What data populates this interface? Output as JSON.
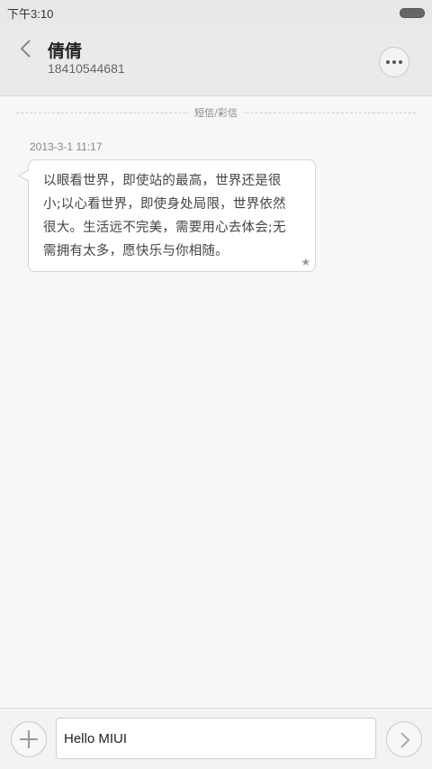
{
  "status_bar": {
    "time": "下午3:10"
  },
  "header": {
    "contact_name": "倩倩",
    "phone_number": "18410544681"
  },
  "conversation": {
    "divider_label": "短信/彩信",
    "messages": [
      {
        "timestamp": "2013-3-1 11:17",
        "text": "以眼看世界，即使站的最高，世界还是很小;以心看世界，即使身处局限，世界依然很大。生活远不完美，需要用心去体会;无需拥有太多，愿快乐与你相随。",
        "starred": true
      }
    ]
  },
  "composer": {
    "input_value": "Hello MIUI"
  },
  "icons": {
    "back": "chevron-left-icon",
    "more": "more-dots-icon",
    "star": "star-icon",
    "attach": "plus-icon",
    "send": "chevron-right-icon",
    "battery": "battery-icon"
  }
}
